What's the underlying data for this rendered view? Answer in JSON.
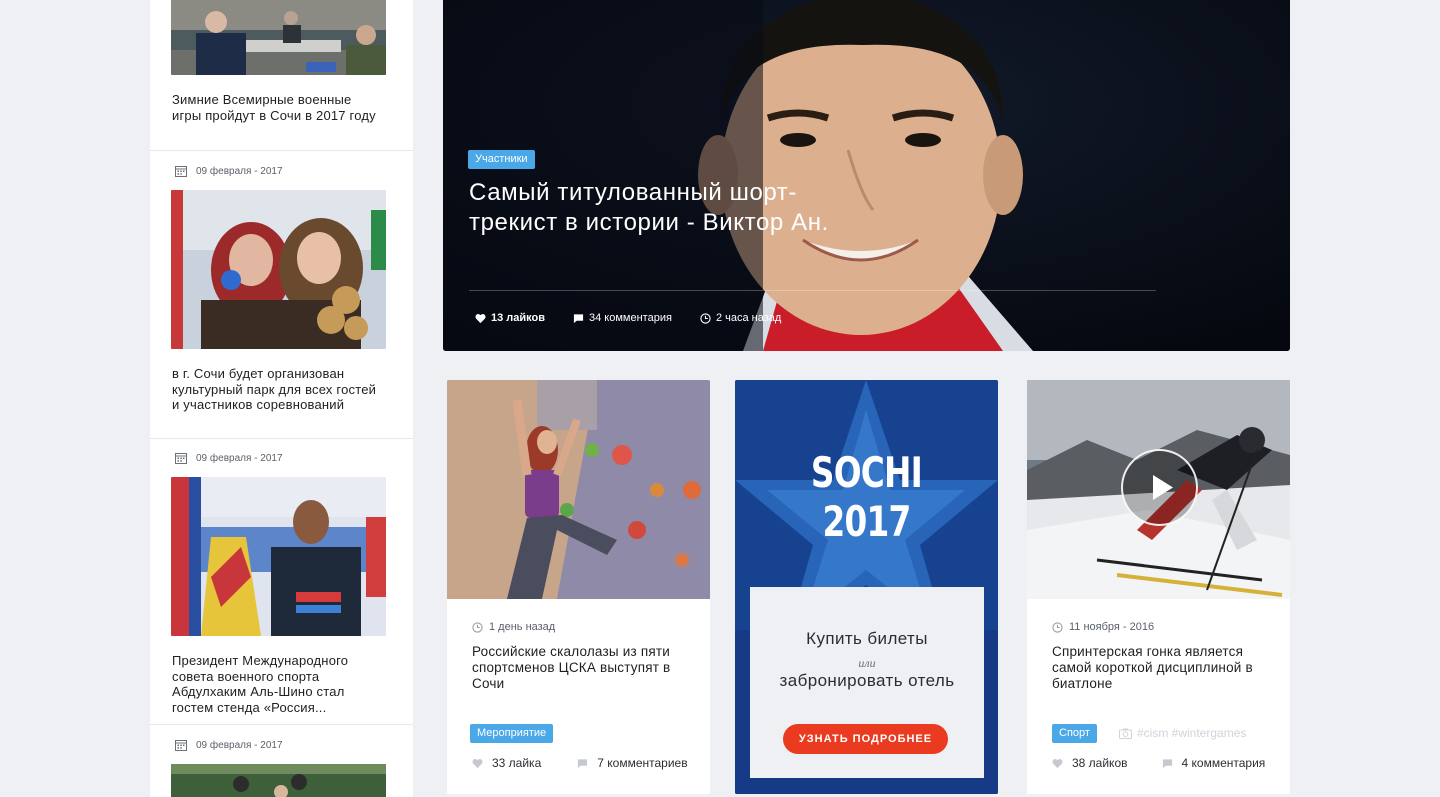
{
  "sidebar": {
    "items": [
      {
        "date": "",
        "title": "Зимние Всемирные военные игры пройдут в Сочи в 2017 году"
      },
      {
        "date": "09 февраля - 2017",
        "title": "в г. Сочи будет организован культурный парк для всех гостей и участников соревнований"
      },
      {
        "date": "09 февраля - 2017",
        "title": "Президент Международного совета военного спорта Абдулхаким Аль-Шино стал гостем стенда «Россия..."
      },
      {
        "date": "09 февраля - 2017",
        "title": ""
      }
    ]
  },
  "hero": {
    "tag": "Участники",
    "title": "Самый титулованный шорт-трекист в истории - Виктор Ан.",
    "likes": "13 лайков",
    "comments": "34 комментария",
    "time": "2 часа назад"
  },
  "cards": [
    {
      "date": "1 день назад",
      "title": "Российские скалолазы из пяти спортсменов ЦСКА выступят в Сочи",
      "tag": "Мероприятие",
      "likes": "33 лайка",
      "comments": "7 комментариев"
    },
    {
      "date": "11 ноября - 2016",
      "title": "Спринтерская гонка является самой короткой дисциплиной в биатлоне",
      "tag": "Спорт",
      "hashtags": "#cism #wintergames",
      "likes": "38 лайков",
      "comments": "4 комментария"
    }
  ],
  "promo": {
    "logo": "SOCHI 2017",
    "line1": "Купить билеты",
    "or": "или",
    "line2": "забронировать отель",
    "button": "УЗНАТЬ ПОДРОБНЕЕ"
  },
  "colors": {
    "accent_tag": "#4aa8e8",
    "promo_bg": "#163a86",
    "promo_button": "#ea3a1f",
    "page_bg": "#eef0f3"
  }
}
